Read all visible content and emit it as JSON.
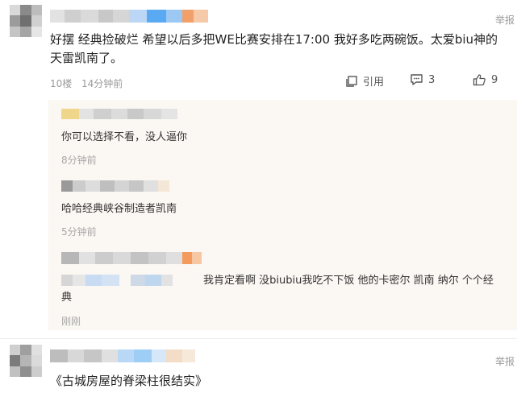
{
  "report_label": "举报",
  "comment1": {
    "text": "好摆 经典捡破烂 希望以后多把WE比赛安排在17:00 我好多吃两碗饭。太爱biu神的天雷凯南了。",
    "floor": "10楼",
    "time": "14分钟前",
    "quote_label": "引用",
    "reply_count": "3",
    "like_count": "9"
  },
  "replies": [
    {
      "text": "你可以选择不看，没人逼你",
      "time": "8分钟前"
    },
    {
      "text": "哈哈经典峡谷制造者凯南",
      "time": "5分钟前"
    },
    {
      "text": "我肯定看啊 没biubiu我吃不下饭 他的卡密尔 凯南 纳尔 个个经典",
      "time": "刚刚"
    }
  ],
  "comment2": {
    "text": "《古城房屋的脊梁柱很结实》"
  },
  "icons": {
    "quote": "quote-icon",
    "comment": "comment-bubble-icon",
    "like": "thumbs-up-icon"
  },
  "colors": {
    "reply_background": "#fbf7f2",
    "meta_gray": "#9a9a9a"
  }
}
